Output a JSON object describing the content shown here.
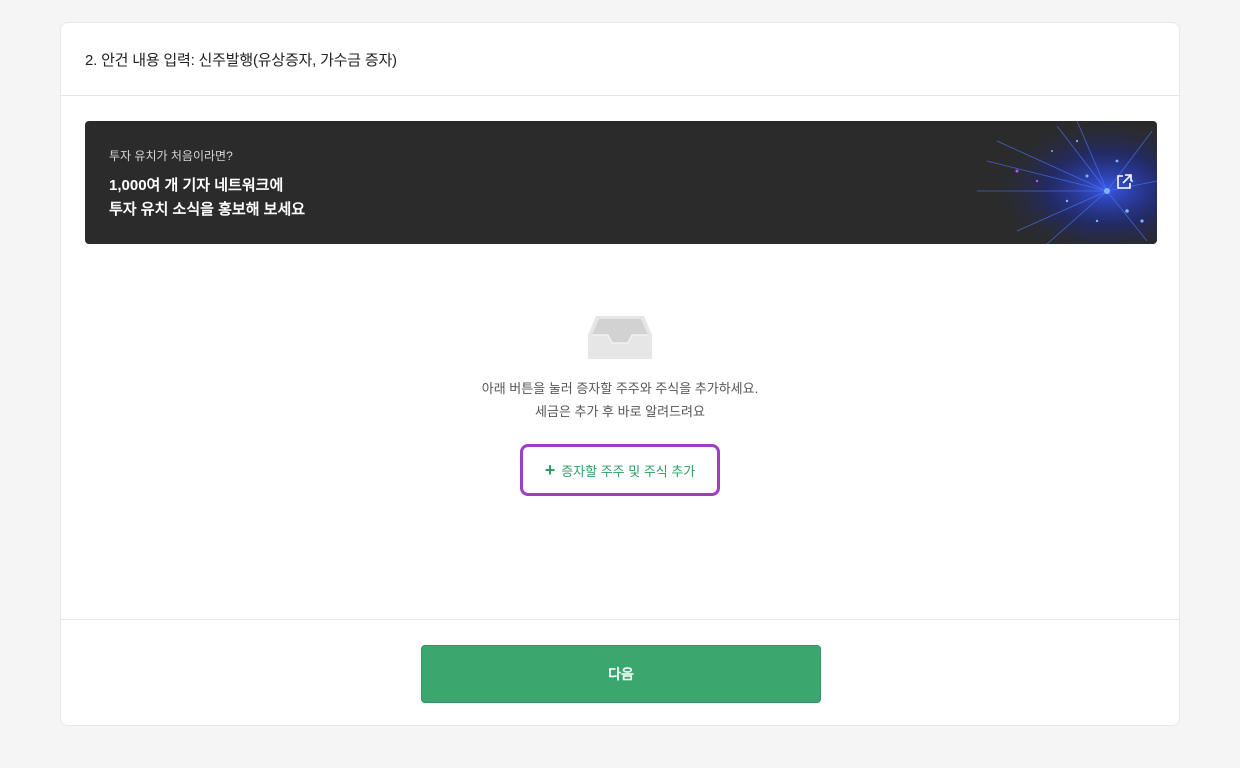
{
  "header": {
    "title": "2. 안건 내용 입력: 신주발행(유상증자, 가수금 증자)"
  },
  "banner": {
    "subtitle": "투자 유치가 처음이라면?",
    "line1": "1,000여 개 기자 네트워크에",
    "line2": "투자 유치 소식을 홍보해 보세요",
    "link_icon": "external-link-icon"
  },
  "empty_state": {
    "icon": "inbox-icon",
    "message_line1": "아래 버튼을 눌러 증자할 주주와 주식을 추가하세요.",
    "message_line2": "세금은 추가 후 바로 알려드려요",
    "add_button_plus": "+",
    "add_button_label": "증자할 주주 및 주식 추가"
  },
  "footer": {
    "next_label": "다음"
  },
  "colors": {
    "accent_green": "#3ba66e",
    "highlight_purple": "#9b3fc8",
    "banner_bg": "#2b2b2b"
  }
}
